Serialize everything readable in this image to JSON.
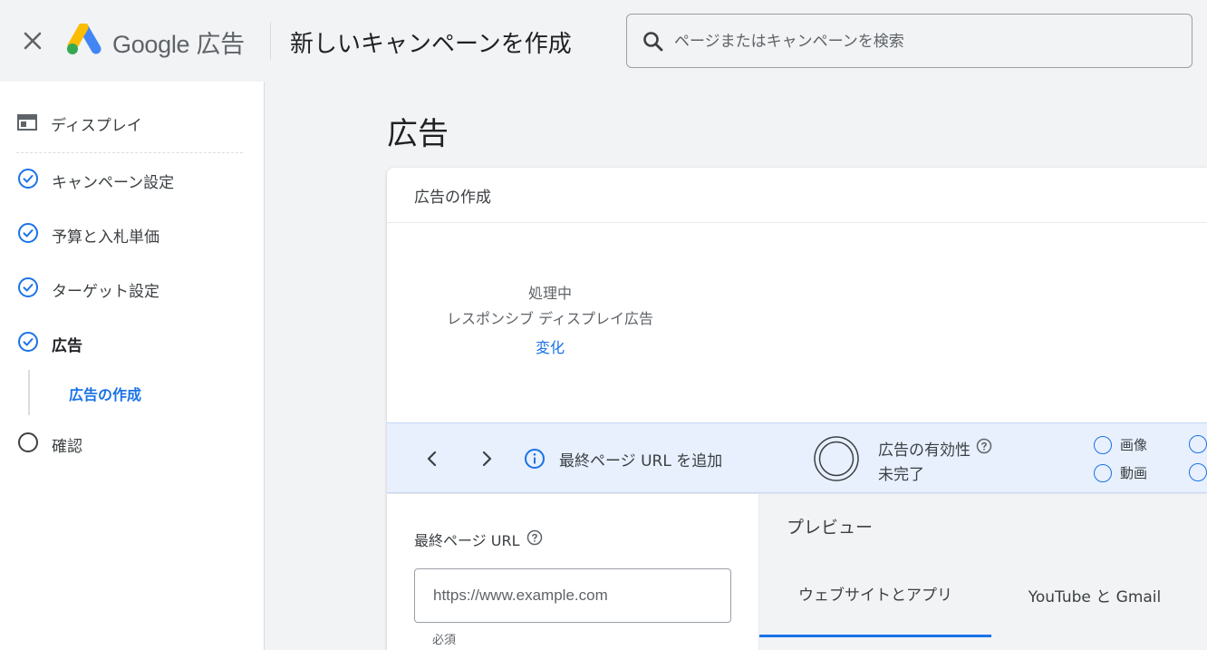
{
  "header": {
    "brand": "Google 広告",
    "title": "新しいキャンペーンを作成",
    "search_placeholder": "ページまたはキャンペーンを検索"
  },
  "sidebar": {
    "top_item": "ディスプレイ",
    "items": [
      {
        "label": "キャンペーン設定",
        "state": "done"
      },
      {
        "label": "予算と入札単価",
        "state": "done"
      },
      {
        "label": "ターゲット設定",
        "state": "done"
      },
      {
        "label": "広告",
        "state": "active"
      },
      {
        "label": "確認",
        "state": "pending"
      }
    ],
    "sub_item": "広告の作成"
  },
  "main": {
    "title": "広告",
    "card": {
      "title": "広告の作成",
      "processing": {
        "status": "処理中",
        "ad_type": "レスポンシブ ディスプレイ広告",
        "change_link": "変化"
      },
      "status_bar": {
        "message": "最終ページ URL を追加",
        "effectiveness_label": "広告の有効性",
        "effectiveness_value": "未完了",
        "checklist": [
          "画像",
          "動画"
        ]
      },
      "form": {
        "url_label": "最終ページ URL",
        "url_placeholder": "https://www.example.com",
        "required": "必須"
      },
      "preview": {
        "title": "プレビュー",
        "tabs": [
          "ウェブサイトとアプリ",
          "YouTube と Gmail"
        ]
      }
    }
  },
  "colors": {
    "accent": "#1a73e8",
    "background": "#f1f3f4",
    "status_bar": "#e8f0fe"
  }
}
